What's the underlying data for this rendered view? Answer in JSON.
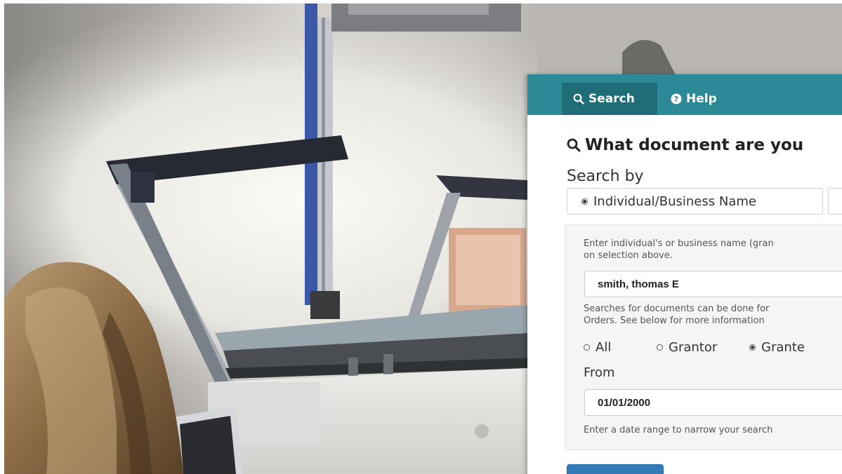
{
  "colors": {
    "nav_bg": "#2b8a95",
    "nav_active": "#1f6e77",
    "primary_button": "#337ab7",
    "well_bg": "#f5f5f5"
  },
  "nav": {
    "tabs": [
      {
        "label": "Search",
        "icon": "search-icon",
        "active": true
      },
      {
        "label": "Help",
        "icon": "question-circle-icon",
        "active": false
      }
    ]
  },
  "panel": {
    "title": "What document are you",
    "title_icon": "search-icon",
    "search_by_label": "Search by",
    "search_by_options": [
      {
        "label": "Individual/Business Name",
        "selected": true
      },
      {
        "label": "",
        "selected": false
      }
    ]
  },
  "form": {
    "name_help_line1": "Enter individual's or business name (gran",
    "name_help_line2": "on selection above.",
    "name_value": "smith, thomas E",
    "doc_help_line1": "Searches for documents can be done for",
    "doc_help_line2": "Orders. See below for more information",
    "party_options": [
      {
        "label": "All",
        "selected": false
      },
      {
        "label": "Grantor",
        "selected": false
      },
      {
        "label": "Grante",
        "selected": true
      }
    ],
    "from_label": "From",
    "from_value": "01/01/2000",
    "date_help": "Enter a date range to narrow your search",
    "submit_label": ""
  }
}
